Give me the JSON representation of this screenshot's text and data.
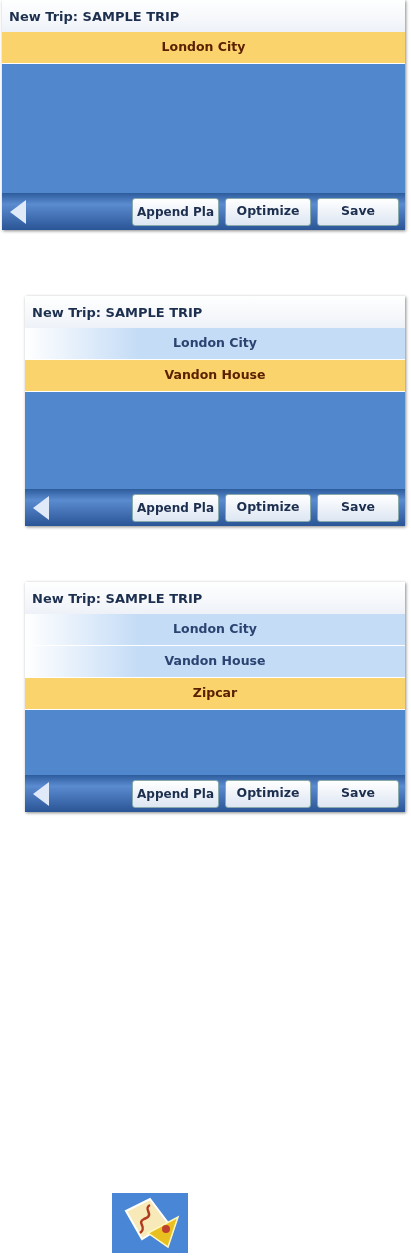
{
  "screens": [
    {
      "title": "New Trip: SAMPLE TRIP",
      "rows": [
        {
          "label": "London City",
          "selected": true
        }
      ],
      "buttons": [
        "Append Pla",
        "Optimize",
        "Save"
      ]
    },
    {
      "title": "New Trip: SAMPLE TRIP",
      "rows": [
        {
          "label": "London City",
          "selected": false
        },
        {
          "label": "Vandon House",
          "selected": true
        }
      ],
      "buttons": [
        "Append Pla",
        "Optimize",
        "Save"
      ]
    },
    {
      "title": "New Trip: SAMPLE TRIP",
      "rows": [
        {
          "label": "London City",
          "selected": false
        },
        {
          "label": "Vandon House",
          "selected": false
        },
        {
          "label": "Zipcar",
          "selected": true
        }
      ],
      "buttons": [
        "Append Pla",
        "Optimize",
        "Save"
      ]
    }
  ]
}
